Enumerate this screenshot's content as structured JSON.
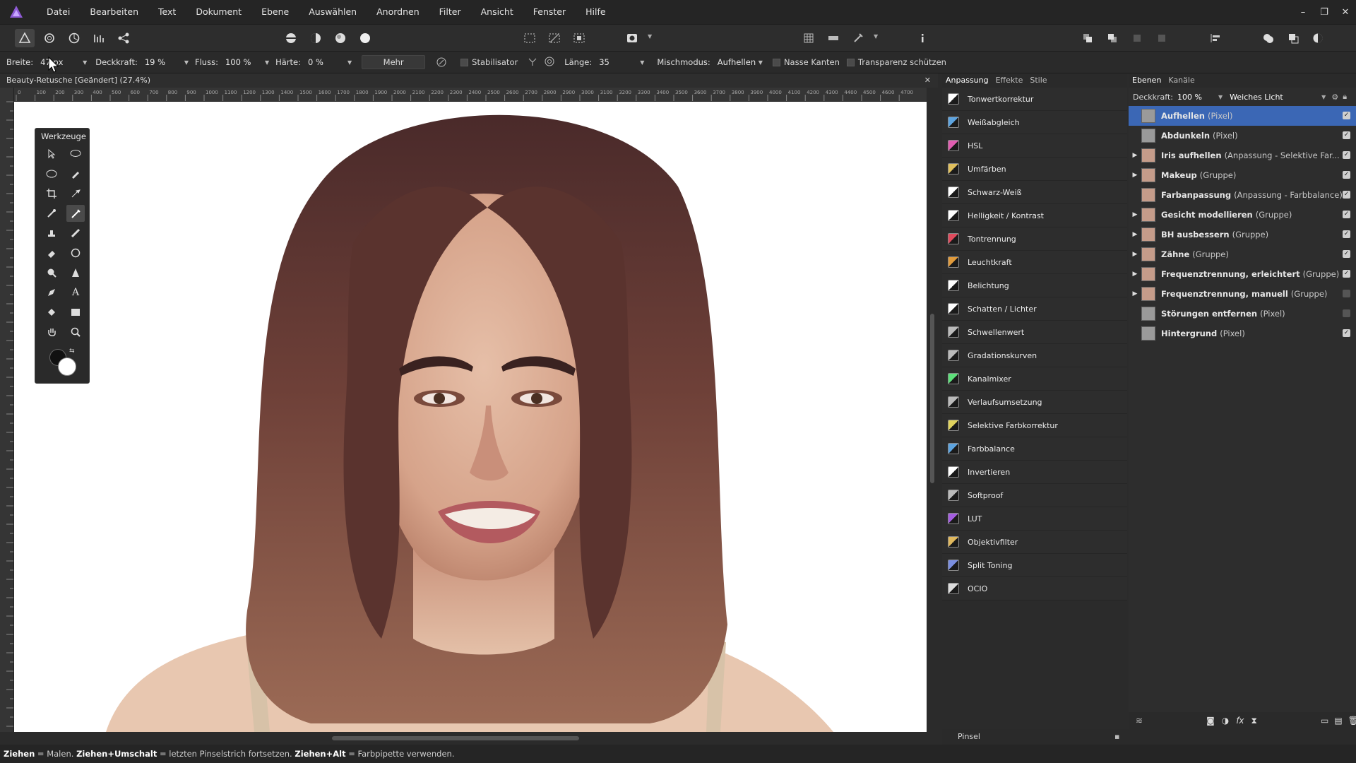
{
  "menubar": {
    "items": [
      "Datei",
      "Bearbeiten",
      "Text",
      "Dokument",
      "Ebene",
      "Auswählen",
      "Anordnen",
      "Filter",
      "Ansicht",
      "Fenster",
      "Hilfe"
    ]
  },
  "context_bar": {
    "breite_label": "Breite:",
    "breite_value": "47 px",
    "deckkraft_label": "Deckkraft:",
    "deckkraft_value": "19 %",
    "fluss_label": "Fluss:",
    "fluss_value": "100 %",
    "haerte_label": "Härte:",
    "haerte_value": "0 %",
    "mehr_label": "Mehr",
    "stabilisator_label": "Stabilisator",
    "laenge_label": "Länge:",
    "laenge_value": "35",
    "mischmodus_label": "Mischmodus:",
    "mischmodus_value": "Aufhellen",
    "nasse_kanten_label": "Nasse Kanten",
    "transparenz_label": "Transparenz schützen"
  },
  "document": {
    "tab_title": "Beauty-Retusche [Geändert] (27.4%)"
  },
  "ruler_h_labels": [
    "0",
    "100",
    "200",
    "300",
    "400",
    "500",
    "600",
    "700",
    "800",
    "900",
    "1000",
    "1100",
    "1200",
    "1300",
    "1400",
    "1500",
    "1600",
    "1700",
    "1800",
    "1900",
    "2000",
    "2100",
    "2200",
    "2300",
    "2400",
    "2500",
    "2600",
    "2700",
    "2800",
    "2900",
    "3000",
    "3100",
    "3200",
    "3300",
    "3400",
    "3500",
    "3600",
    "3700",
    "3800",
    "3900",
    "4000",
    "4100",
    "4200",
    "4300",
    "4400",
    "4500",
    "4600",
    "4700"
  ],
  "tools": {
    "title": "Werkzeuge"
  },
  "adjustment_panel": {
    "tabs": [
      "Anpassung",
      "Effekte",
      "Stile"
    ],
    "items": [
      {
        "label": "Tonwertkorrektur",
        "color": "#ffffff"
      },
      {
        "label": "Weißabgleich",
        "color": "#5da4e0"
      },
      {
        "label": "HSL",
        "color": "#e05db0"
      },
      {
        "label": "Umfärben",
        "color": "#e0c05d"
      },
      {
        "label": "Schwarz-Weiß",
        "color": "#ffffff"
      },
      {
        "label": "Helligkeit / Kontrast",
        "color": "#ffffff"
      },
      {
        "label": "Tontrennung",
        "color": "#e04b5d"
      },
      {
        "label": "Leuchtkraft",
        "color": "#e09a3b"
      },
      {
        "label": "Belichtung",
        "color": "#ffffff"
      },
      {
        "label": "Schatten / Lichter",
        "color": "#ffffff"
      },
      {
        "label": "Schwellenwert",
        "color": "#bbbbbb"
      },
      {
        "label": "Gradationskurven",
        "color": "#bbbbbb"
      },
      {
        "label": "Kanalmixer",
        "color": "#5de07a"
      },
      {
        "label": "Verlaufsumsetzung",
        "color": "#bbbbbb"
      },
      {
        "label": "Selektive Farbkorrektur",
        "color": "#e0d35d"
      },
      {
        "label": "Farbbalance",
        "color": "#5da4e0"
      },
      {
        "label": "Invertieren",
        "color": "#ffffff"
      },
      {
        "label": "Softproof",
        "color": "#bbbbbb"
      },
      {
        "label": "LUT",
        "color": "#a45de0"
      },
      {
        "label": "Objektivfilter",
        "color": "#e0b85d"
      },
      {
        "label": "Split Toning",
        "color": "#7a8ee0"
      },
      {
        "label": "OCIO",
        "color": "#dddddd"
      }
    ]
  },
  "layers_panel": {
    "tabs": [
      "Ebenen",
      "Kanäle"
    ],
    "deckkraft_label": "Deckkraft:",
    "deckkraft_value": "100 %",
    "blend_mode": "Weiches Licht",
    "layers": [
      {
        "name": "Aufhellen",
        "type": "(Pixel)",
        "expandable": false,
        "selected": true,
        "visible": true
      },
      {
        "name": "Abdunkeln",
        "type": "(Pixel)",
        "expandable": false,
        "selected": false,
        "visible": true
      },
      {
        "name": "Iris aufhellen",
        "type": "(Anpassung - Selektive Far...",
        "expandable": true,
        "selected": false,
        "visible": true
      },
      {
        "name": "Makeup",
        "type": "(Gruppe)",
        "expandable": true,
        "selected": false,
        "visible": true
      },
      {
        "name": "Farbanpassung",
        "type": "(Anpassung - Farbbalance)",
        "expandable": false,
        "selected": false,
        "visible": true
      },
      {
        "name": "Gesicht modellieren",
        "type": "(Gruppe)",
        "expandable": true,
        "selected": false,
        "visible": true
      },
      {
        "name": "BH ausbessern",
        "type": "(Gruppe)",
        "expandable": true,
        "selected": false,
        "visible": true
      },
      {
        "name": "Zähne",
        "type": "(Gruppe)",
        "expandable": true,
        "selected": false,
        "visible": true
      },
      {
        "name": "Frequenztrennung, erleichtert",
        "type": "(Gruppe)",
        "expandable": true,
        "selected": false,
        "visible": true
      },
      {
        "name": "Frequenztrennung, manuell",
        "type": "(Gruppe)",
        "expandable": true,
        "selected": false,
        "visible": false
      },
      {
        "name": "Störungen entfernen",
        "type": "(Pixel)",
        "expandable": false,
        "selected": false,
        "visible": false
      },
      {
        "name": "Hintergrund",
        "type": "(Pixel)",
        "expandable": false,
        "selected": false,
        "visible": true
      }
    ]
  },
  "brush_panel": {
    "title": "Pinsel"
  },
  "statusbar": {
    "k1": "Ziehen",
    "t1": " = Malen. ",
    "k2": "Ziehen+Umschalt",
    "t2": " = letzten Pinselstrich fortsetzen. ",
    "k3": "Ziehen+Alt",
    "t3": " = Farbpipette verwenden."
  },
  "colors": {
    "accent": "#3b67b5",
    "app_bg": "#2b2b2b",
    "canvas": "#ffffff"
  }
}
